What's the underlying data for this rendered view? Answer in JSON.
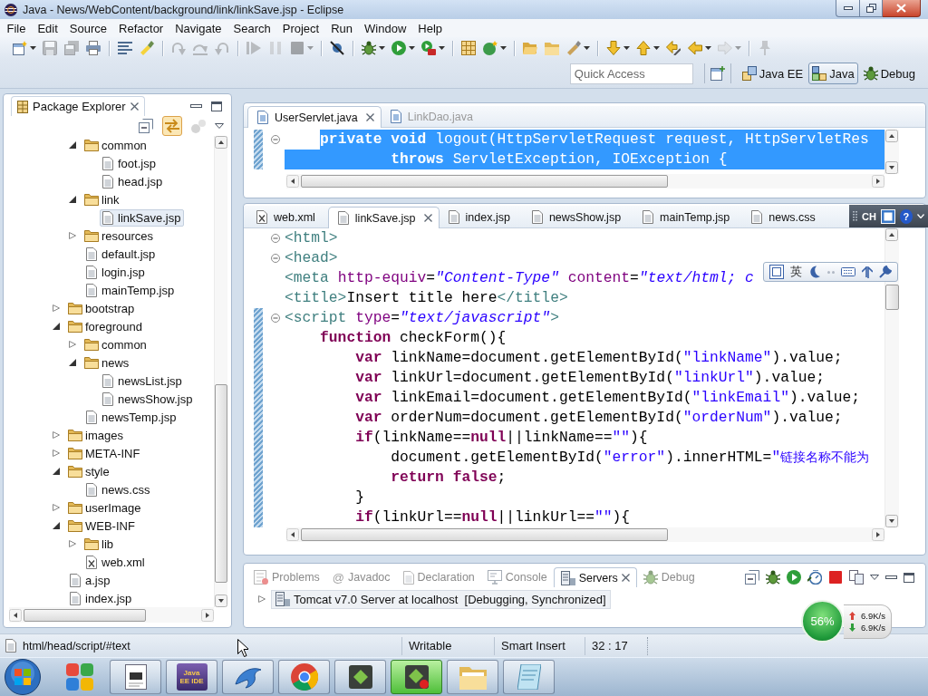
{
  "window": {
    "title": "Java - News/WebContent/background/link/linkSave.jsp - Eclipse"
  },
  "menu": [
    "File",
    "Edit",
    "Source",
    "Refactor",
    "Navigate",
    "Search",
    "Project",
    "Run",
    "Window",
    "Help"
  ],
  "toolbar": [
    [
      {
        "kind": "new",
        "disabled": false,
        "dropdown": true
      },
      {
        "kind": "save",
        "disabled": true,
        "dropdown": false
      },
      {
        "kind": "save_all",
        "disabled": true,
        "dropdown": false
      },
      {
        "kind": "print",
        "disabled": false,
        "dropdown": false
      }
    ],
    [
      {
        "kind": "whitespace",
        "disabled": false,
        "dropdown": false
      },
      {
        "kind": "highlight",
        "disabled": false,
        "dropdown": false
      }
    ],
    [
      {
        "kind": "step_into",
        "disabled": true,
        "dropdown": false
      },
      {
        "kind": "step_over",
        "disabled": true,
        "dropdown": false
      },
      {
        "kind": "step_return",
        "disabled": true,
        "dropdown": false
      }
    ],
    [
      {
        "kind": "resume",
        "disabled": true,
        "dropdown": false
      },
      {
        "kind": "suspend",
        "disabled": true,
        "dropdown": false
      },
      {
        "kind": "terminate",
        "disabled": true,
        "dropdown": true
      }
    ],
    [
      {
        "kind": "skip_breakpoints",
        "disabled": false,
        "dropdown": false
      }
    ],
    [
      {
        "kind": "debug",
        "disabled": false,
        "dropdown": true
      },
      {
        "kind": "run",
        "disabled": false,
        "dropdown": true
      },
      {
        "kind": "external_tools",
        "disabled": false,
        "dropdown": true
      }
    ],
    [
      {
        "kind": "new_project",
        "disabled": false,
        "dropdown": false
      },
      {
        "kind": "new_class",
        "disabled": false,
        "dropdown": true
      }
    ],
    [
      {
        "kind": "open_type",
        "disabled": false,
        "dropdown": false
      },
      {
        "kind": "open_task",
        "disabled": false,
        "dropdown": false
      },
      {
        "kind": "search",
        "disabled": false,
        "dropdown": true
      }
    ],
    [
      {
        "kind": "next_annotation",
        "disabled": false,
        "dropdown": true
      },
      {
        "kind": "prev_annotation",
        "disabled": false,
        "dropdown": true
      },
      {
        "kind": "last_edit",
        "disabled": false,
        "dropdown": false
      },
      {
        "kind": "back",
        "disabled": false,
        "dropdown": true
      },
      {
        "kind": "forward",
        "disabled": true,
        "dropdown": true
      }
    ],
    [
      {
        "kind": "pin",
        "disabled": true,
        "dropdown": false
      }
    ]
  ],
  "quick_access": {
    "placeholder": "Quick Access"
  },
  "perspectives": [
    {
      "kind": "java_ee",
      "label": "Java EE",
      "selected": false
    },
    {
      "kind": "java",
      "label": "Java",
      "selected": true
    },
    {
      "kind": "debug",
      "label": "Debug",
      "selected": false
    }
  ],
  "package_explorer": {
    "title": "Package Explorer",
    "view_toolbar": [
      {
        "kind": "collapse_all",
        "on": false,
        "disabled": false
      },
      {
        "kind": "link_editor",
        "on": true,
        "disabled": false
      },
      {
        "kind": "focus",
        "on": false,
        "disabled": true
      }
    ],
    "tree": [
      {
        "children": [
          {
            "label": "common",
            "kind": "folder",
            "expanded": true,
            "selected": false,
            "children": [
              {
                "label": "foot.jsp",
                "kind": "file",
                "selected": false
              },
              {
                "label": "head.jsp",
                "kind": "file",
                "selected": false
              }
            ]
          },
          {
            "label": "link",
            "kind": "folder",
            "expanded": true,
            "selected": false,
            "children": [
              {
                "label": "linkSave.jsp",
                "kind": "file",
                "selected": true
              }
            ]
          },
          {
            "label": "resources",
            "kind": "folder",
            "expanded": false,
            "selected": false
          },
          {
            "label": "default.jsp",
            "kind": "file",
            "selected": false
          },
          {
            "label": "login.jsp",
            "kind": "file",
            "selected": false
          },
          {
            "label": "mainTemp.jsp",
            "kind": "file",
            "selected": false
          }
        ]
      },
      {
        "label": "bootstrap",
        "kind": "folder",
        "expanded": false,
        "selected": false
      },
      {
        "label": "foreground",
        "kind": "folder",
        "expanded": true,
        "selected": false,
        "children": [
          {
            "label": "common",
            "kind": "folder",
            "expanded": false,
            "selected": false
          },
          {
            "label": "news",
            "kind": "folder",
            "expanded": true,
            "selected": false,
            "children": [
              {
                "label": "newsList.jsp",
                "kind": "file",
                "selected": false
              },
              {
                "label": "newsShow.jsp",
                "kind": "file",
                "selected": false
              }
            ]
          },
          {
            "label": "newsTemp.jsp",
            "kind": "file",
            "selected": false
          }
        ]
      },
      {
        "label": "images",
        "kind": "folder",
        "expanded": false,
        "selected": false
      },
      {
        "label": "META-INF",
        "kind": "folder",
        "expanded": false,
        "selected": false
      },
      {
        "label": "style",
        "kind": "folder",
        "expanded": true,
        "selected": false,
        "children": [
          {
            "label": "news.css",
            "kind": "file",
            "selected": false
          }
        ]
      },
      {
        "label": "userImage",
        "kind": "folder",
        "expanded": false,
        "selected": false
      },
      {
        "label": "WEB-INF",
        "kind": "folder",
        "expanded": true,
        "selected": false,
        "children": [
          {
            "label": "lib",
            "kind": "folder",
            "expanded": false,
            "selected": false
          },
          {
            "label": "web.xml",
            "kind": "xml",
            "selected": false
          }
        ]
      },
      {
        "label": "a.jsp",
        "kind": "file",
        "selected": false
      },
      {
        "label": "index.jsp",
        "kind": "file",
        "selected": false
      }
    ]
  },
  "editor_top": {
    "tabs": [
      {
        "kind": "java",
        "label": "UserServlet.java",
        "selected": true,
        "greyed": false
      },
      {
        "kind": "java",
        "label": "LinkDao.java",
        "selected": false,
        "greyed": true
      }
    ],
    "lines": [
      {
        "fold": true,
        "marked": true,
        "selected": true,
        "selection_start": true,
        "tokens": [
          {
            "kind": "keyword",
            "text": "    private"
          },
          {
            "kind": "keyword",
            "text": " void"
          },
          {
            "kind": "plain",
            "text": " logout(HttpServletRequest request, HttpServletRes"
          }
        ]
      },
      {
        "fold": false,
        "marked": true,
        "selected": true,
        "selection_start": false,
        "tokens": [
          {
            "kind": "keyword",
            "text": "            throws"
          },
          {
            "kind": "plain",
            "text": " ServletException, IOException {"
          }
        ]
      }
    ]
  },
  "editor_main": {
    "tabs": [
      {
        "kind": "xml",
        "label": "web.xml",
        "selected": false
      },
      {
        "kind": "jsp",
        "label": "linkSave.jsp",
        "selected": true
      },
      {
        "kind": "jsp",
        "label": "index.jsp",
        "selected": false
      },
      {
        "kind": "jsp",
        "label": "newsShow.jsp",
        "selected": false
      },
      {
        "kind": "jsp",
        "label": "mainTemp.jsp",
        "selected": false
      },
      {
        "kind": "css",
        "label": "news.css",
        "selected": false
      }
    ],
    "lines": [
      {
        "fold": true,
        "marked": false,
        "tokens": [
          {
            "kind": "tag",
            "text": "<html>"
          }
        ]
      },
      {
        "fold": true,
        "marked": false,
        "tokens": [
          {
            "kind": "tag",
            "text": "<head>"
          }
        ]
      },
      {
        "fold": false,
        "marked": false,
        "tokens": [
          {
            "kind": "tag",
            "text": "<meta "
          },
          {
            "kind": "attr",
            "text": "http-equiv"
          },
          {
            "kind": "plain",
            "text": "="
          },
          {
            "kind": "value",
            "text": "\"Content-Type\""
          },
          {
            "kind": "attr",
            "text": " content"
          },
          {
            "kind": "plain",
            "text": "="
          },
          {
            "kind": "value",
            "text": "\"text/html; c"
          }
        ]
      },
      {
        "fold": false,
        "marked": false,
        "tokens": [
          {
            "kind": "tag",
            "text": "<title>"
          },
          {
            "kind": "plain",
            "text": "Insert title here"
          },
          {
            "kind": "tag",
            "text": "</title>"
          }
        ]
      },
      {
        "fold": true,
        "marked": true,
        "tokens": [
          {
            "kind": "tag",
            "text": "<script "
          },
          {
            "kind": "attr",
            "text": "type"
          },
          {
            "kind": "plain",
            "text": "="
          },
          {
            "kind": "value",
            "text": "\"text/javascript\""
          },
          {
            "kind": "tag",
            "text": ">"
          }
        ]
      },
      {
        "fold": false,
        "marked": true,
        "tokens": [
          {
            "kind": "keyword",
            "text": "    function"
          },
          {
            "kind": "plain",
            "text": " checkForm(){"
          }
        ]
      },
      {
        "fold": false,
        "marked": true,
        "tokens": [
          {
            "kind": "keyword",
            "text": "        var"
          },
          {
            "kind": "plain",
            "text": " linkName=document.getElementById("
          },
          {
            "kind": "string",
            "text": "\"linkName\""
          },
          {
            "kind": "plain",
            "text": ").value;"
          }
        ]
      },
      {
        "fold": false,
        "marked": true,
        "tokens": [
          {
            "kind": "keyword",
            "text": "        var"
          },
          {
            "kind": "plain",
            "text": " linkUrl=document.getElementById("
          },
          {
            "kind": "string",
            "text": "\"linkUrl\""
          },
          {
            "kind": "plain",
            "text": ").value;"
          }
        ]
      },
      {
        "fold": false,
        "marked": true,
        "tokens": [
          {
            "kind": "keyword",
            "text": "        var"
          },
          {
            "kind": "plain",
            "text": " linkEmail=document.getElementById("
          },
          {
            "kind": "string",
            "text": "\"linkEmail\""
          },
          {
            "kind": "plain",
            "text": ").value;"
          }
        ]
      },
      {
        "fold": false,
        "marked": true,
        "tokens": [
          {
            "kind": "keyword",
            "text": "        var"
          },
          {
            "kind": "plain",
            "text": " orderNum=document.getElementById("
          },
          {
            "kind": "string",
            "text": "\"orderNum\""
          },
          {
            "kind": "plain",
            "text": ").value;"
          }
        ]
      },
      {
        "fold": false,
        "marked": true,
        "tokens": [
          {
            "kind": "keyword",
            "text": "        if"
          },
          {
            "kind": "plain",
            "text": "(linkName=="
          },
          {
            "kind": "keyword",
            "text": "null"
          },
          {
            "kind": "plain",
            "text": "||linkName=="
          },
          {
            "kind": "string",
            "text": "\"\""
          },
          {
            "kind": "plain",
            "text": "){"
          }
        ]
      },
      {
        "fold": false,
        "marked": true,
        "tokens": [
          {
            "kind": "plain",
            "text": "            document.getElementById("
          },
          {
            "kind": "string",
            "text": "\"error\""
          },
          {
            "kind": "plain",
            "text": ").innerHTML="
          },
          {
            "kind": "string",
            "text": "\""
          },
          {
            "kind": "string_cjk",
            "text": "链接名称不能为"
          }
        ]
      },
      {
        "fold": false,
        "marked": true,
        "tokens": [
          {
            "kind": "keyword",
            "text": "            return"
          },
          {
            "kind": "keyword",
            "text": " false"
          },
          {
            "kind": "plain",
            "text": ";"
          }
        ]
      },
      {
        "fold": false,
        "marked": true,
        "tokens": [
          {
            "kind": "plain",
            "text": "        }"
          }
        ]
      },
      {
        "fold": false,
        "marked": true,
        "tokens": [
          {
            "kind": "keyword",
            "text": "        if"
          },
          {
            "kind": "plain",
            "text": "(linkUrl=="
          },
          {
            "kind": "keyword",
            "text": "null"
          },
          {
            "kind": "plain",
            "text": "||linkUrl=="
          },
          {
            "kind": "string",
            "text": "\"\""
          },
          {
            "kind": "plain",
            "text": "){"
          }
        ]
      }
    ]
  },
  "bottom_panel": {
    "tabs": [
      {
        "kind": "problems",
        "label": "Problems",
        "selected": false
      },
      {
        "kind": "javadoc",
        "glyph": "@",
        "label": "Javadoc",
        "selected": false
      },
      {
        "kind": "declaration",
        "label": "Declaration",
        "selected": false
      },
      {
        "kind": "console",
        "label": "Console",
        "selected": false
      },
      {
        "kind": "servers",
        "label": "Servers",
        "selected": true
      },
      {
        "kind": "debug",
        "label": "Debug",
        "selected": false
      }
    ],
    "servers": [
      {
        "label": "Tomcat v7.0 Server at localhost",
        "status": "[Debugging, Synchronized]",
        "expanded": false
      }
    ]
  },
  "status_bar": {
    "path": "html/head/script/#text",
    "access": "Writable",
    "insert_mode": "Smart Insert",
    "position": "32 : 17"
  },
  "taskbar": [
    {
      "kind": "squares",
      "running": false,
      "active": false
    },
    {
      "kind": "document",
      "running": true,
      "active": false
    },
    {
      "kind": "java_ee",
      "label": "Java EE IDE",
      "running": true,
      "active": false
    },
    {
      "kind": "dolphin",
      "running": true,
      "active": false
    },
    {
      "kind": "browser",
      "running": true,
      "active": false
    },
    {
      "kind": "chip",
      "running": true,
      "active": false
    },
    {
      "kind": "chip_dot",
      "running": true,
      "active": true
    },
    {
      "kind": "folder",
      "running": true,
      "active": false
    },
    {
      "kind": "notepad",
      "running": true,
      "active": false
    }
  ],
  "ime_status": {
    "language": "CH",
    "help": "?"
  },
  "ime_toolbar": {
    "mode": "英"
  },
  "network_monitor": {
    "usage": "56%",
    "upload": "6.9K/s",
    "download": "6.9K/s"
  }
}
